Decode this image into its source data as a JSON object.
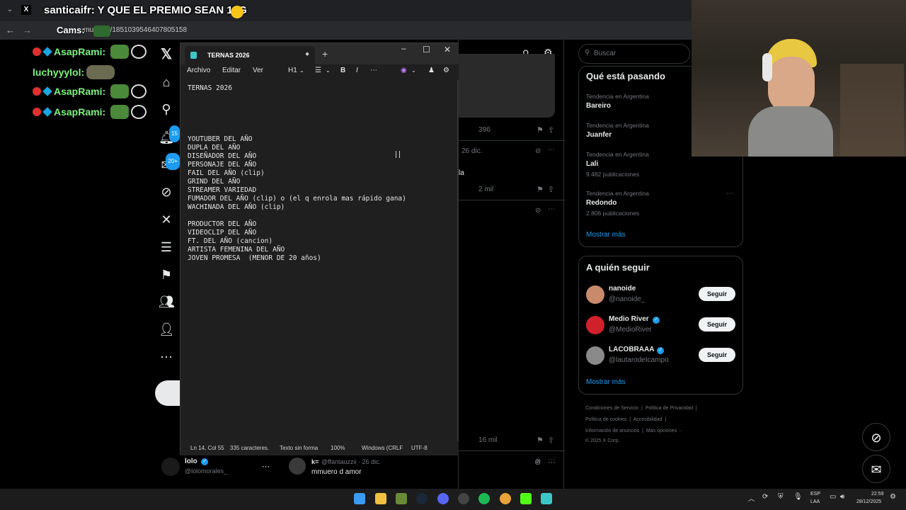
{
  "browser": {
    "tab_title": "X",
    "url": "x.com/i/communities/1851039546407805158",
    "url_visible": "...munities/1851039546407805158"
  },
  "overlay": {
    "title": "santicaifr: Y QUE EL PREMIO SEAN 10G",
    "cams": "Cams:",
    "chat": [
      {
        "user": "AsapRami:",
        "badges": true
      },
      {
        "user": "luchyyylol:",
        "badges": false
      },
      {
        "user": "AsapRami:",
        "badges": true
      },
      {
        "user": "AsapRami:",
        "badges": true
      }
    ]
  },
  "xnav": {
    "notif_badge": "15",
    "msg_badge": "20+"
  },
  "notepad": {
    "tab_title": "TERNAS 2026",
    "menu": {
      "file": "Archivo",
      "edit": "Editar",
      "view": "Ver",
      "heading": "H1"
    },
    "content": "TERNAS 2026\n\n\n\n\n\nYOUTUBER DEL AÑO\nDUPLA DEL AÑO\nDISEÑADOR DEL AÑO\nPERSONAJE DEL AÑO\nFAIL DEL AÑO (clip)\nGRIND DEL AÑO\nSTREAMER VARIEDAD\nFUMADOR DEL AÑO (clip) o (el q enrola mas rápido gana)\nWACHINADA DEL AÑO (clip)\n\nPRODUCTOR DEL AÑO\nVIDEOCLIP DEL AÑO\nFT. DEL AÑO (cancion)\nARTISTA FEMENINA DEL AÑO\nJOVEN PROMESA  (MENOR DE 20 años)",
    "status": {
      "position": "Ln 14, Col 55",
      "chars": "335 caracteres.",
      "format": "Texto sin forma",
      "zoom": "100%",
      "eol": "Windows (CRLF",
      "encoding": "UTF-8"
    }
  },
  "feed": {
    "views_1": "396",
    "date_1": "26 dic.",
    "frag_1": "la",
    "views_2": "2 mil",
    "views_3": "16 mil",
    "user_name": "lolo",
    "user_handle": "@lolomorales_",
    "reply_user": "k=",
    "reply_handle": "@ffantauzzii · 26 dic.",
    "reply_text": "mmuero d amor"
  },
  "sidebar": {
    "search_placeholder": "Buscar",
    "trends_title": "Qué está pasando",
    "trends": [
      {
        "context": "Tendencia en Argentina",
        "name": "Bareiro",
        "posts": ""
      },
      {
        "context": "Tendencia en Argentina",
        "name": "Juanfer",
        "posts": ""
      },
      {
        "context": "Tendencia en Argentina",
        "name": "Lali",
        "posts": "9.482 publicaciones"
      },
      {
        "context": "Tendencia en Argentina",
        "name": "Redondo",
        "posts": "2.806 publicaciones"
      }
    ],
    "trends_more": "Mostrar más",
    "follow_title": "A quién seguir",
    "follow": [
      {
        "name": "nanoide",
        "handle": "@nanoide_",
        "verified": false,
        "btn": "Seguir",
        "color": "#c98a6b"
      },
      {
        "name": "Medio River",
        "handle": "@MedioRiver",
        "verified": true,
        "btn": "Seguir",
        "color": "#d0202a"
      },
      {
        "name": "LACOBRAAA",
        "handle": "@lautarodeIcampo",
        "verified": true,
        "btn": "Seguir",
        "color": "#8a8a8a"
      }
    ],
    "follow_more": "Mostrar más",
    "footer": {
      "tos": "Condiciones de Servicio",
      "privacy": "Política de Privacidad",
      "cookies": "Política de cookies",
      "accessibility": "Accesibilidad",
      "ads": "Información de anuncios",
      "more": "Más opciones ···",
      "copyright": "© 2025 X Corp."
    }
  },
  "taskbar": {
    "lang": "ESP",
    "region": "LAA",
    "time": "22:59",
    "date": "28/12/2025"
  }
}
